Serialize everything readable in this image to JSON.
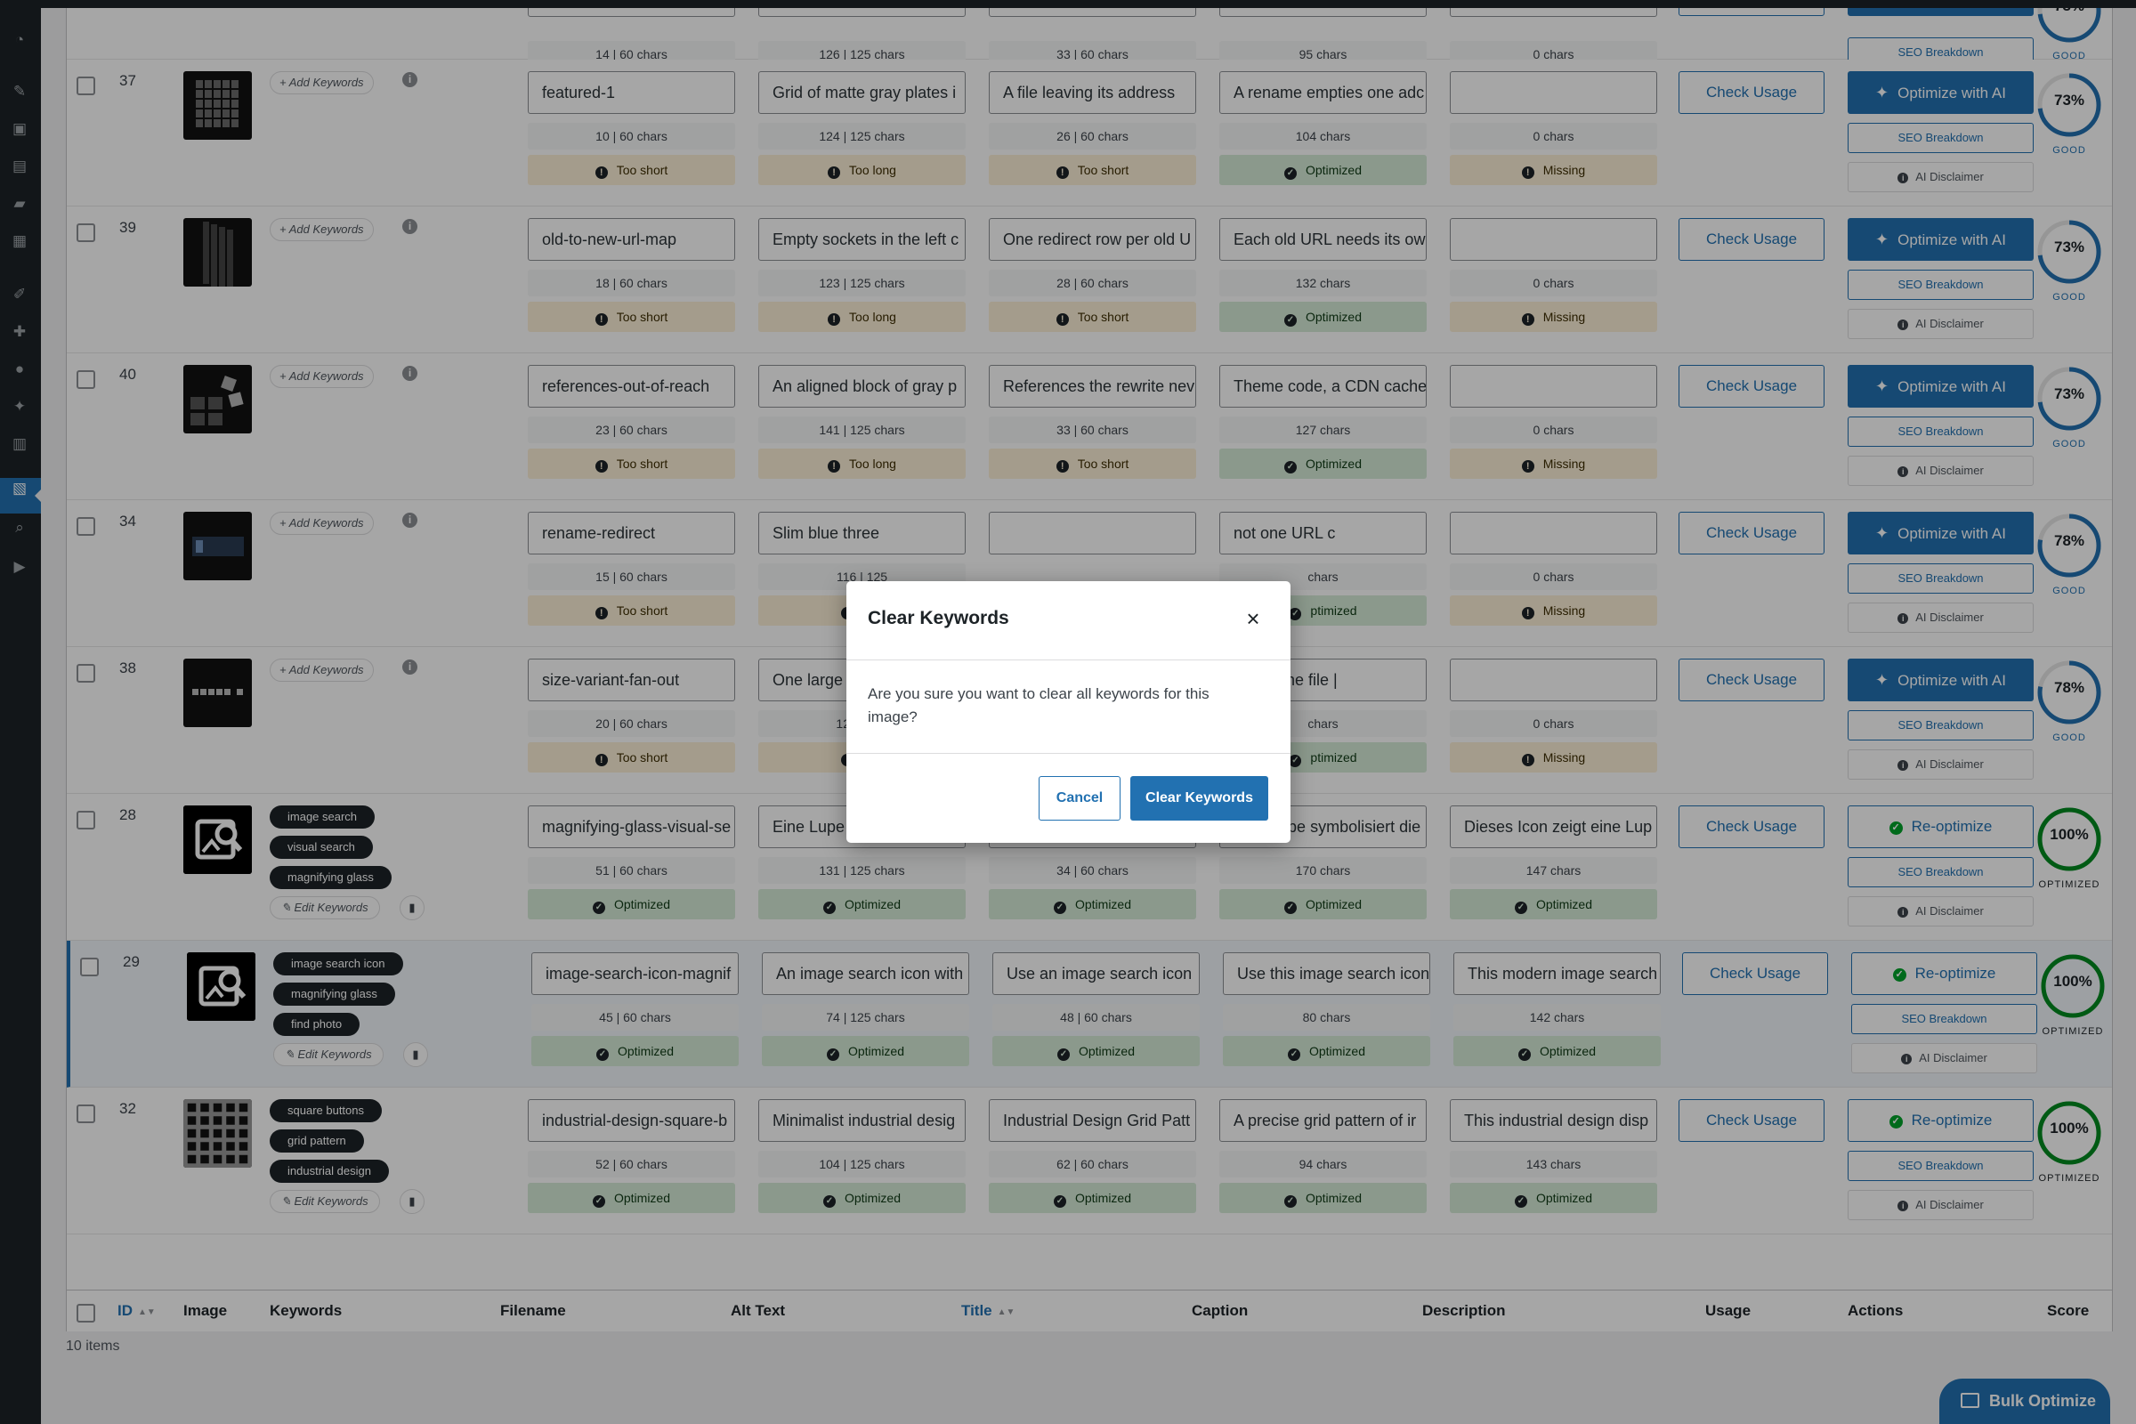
{
  "columns": {
    "id": "ID",
    "image": "Image",
    "keywords": "Keywords",
    "filename": "Filename",
    "alt": "Alt Text",
    "title": "Title",
    "caption": "Caption",
    "description": "Description",
    "usage": "Usage",
    "actions": "Actions",
    "score": "Score"
  },
  "labels": {
    "add_keywords": "Add Keywords",
    "edit_keywords": "Edit Keywords",
    "check_usage": "Check Usage",
    "optimize": "Optimize with AI",
    "reoptimize": "Re-optimize",
    "seo_breakdown": "SEO Breakdown",
    "ai_disclaimer": "AI Disclaimer"
  },
  "top_partial": {
    "counts": [
      "14 | 60 chars",
      "126 | 125 chars",
      "33 | 60 chars",
      "95 chars",
      "0 chars"
    ],
    "statuses": [
      "Too short",
      "Too long",
      "Too short",
      "Optimized",
      "Missing"
    ],
    "score_label": "GOOD",
    "score_pct": "73%",
    "score_value": 0.73,
    "seo_breakdown": "SEO Breakdown",
    "ai_disclaimer": "AI Disclaimer"
  },
  "rows": [
    {
      "id": "37",
      "filename": "featured-1",
      "alt": "Grid of matte gray plates i",
      "title": "A file leaving its address",
      "caption": "A rename empties one adc",
      "description": "",
      "counts": [
        "10 | 60 chars",
        "124 | 125 chars",
        "26 | 60 chars",
        "104 chars",
        "0 chars"
      ],
      "statuses": [
        "Too short",
        "Too long",
        "Too short",
        "Optimized",
        "Missing"
      ],
      "score_pct": "73%",
      "score_value": 0.73,
      "score_label": "GOOD",
      "keywords": [],
      "optimized": false
    },
    {
      "id": "39",
      "filename": "old-to-new-url-map",
      "alt": "Empty sockets in the left c",
      "title": "One redirect row per old U",
      "caption": "Each old URL needs its ow",
      "description": "",
      "counts": [
        "18 | 60 chars",
        "123 | 125 chars",
        "28 | 60 chars",
        "132 chars",
        "0 chars"
      ],
      "statuses": [
        "Too short",
        "Too long",
        "Too short",
        "Optimized",
        "Missing"
      ],
      "score_pct": "73%",
      "score_value": 0.73,
      "score_label": "GOOD",
      "keywords": [],
      "optimized": false
    },
    {
      "id": "40",
      "filename": "references-out-of-reach",
      "alt": "An aligned block of gray p",
      "title": "References the rewrite nev",
      "caption": "Theme code, a CDN cache",
      "description": "",
      "counts": [
        "23 | 60 chars",
        "141 | 125 chars",
        "33 | 60 chars",
        "127 chars",
        "0 chars"
      ],
      "statuses": [
        "Too short",
        "Too long",
        "Too short",
        "Optimized",
        "Missing"
      ],
      "score_pct": "73%",
      "score_value": 0.73,
      "score_label": "GOOD",
      "keywords": [],
      "optimized": false
    },
    {
      "id": "34",
      "filename": "rename-redirect",
      "alt": "Slim blue three",
      "title": "",
      "caption": "not one URL c",
      "description": "",
      "counts": [
        "15 | 60 chars",
        "116 | 125",
        "",
        "chars",
        "0 chars"
      ],
      "statuses": [
        "Too short",
        "Too",
        "",
        "ptimized",
        "Missing"
      ],
      "score_pct": "78%",
      "score_value": 0.78,
      "score_label": "GOOD",
      "keywords": [],
      "optimized": false
    },
    {
      "id": "38",
      "filename": "size-variant-fan-out",
      "alt": "One large gray",
      "title": "",
      "caption": "omes one file |",
      "description": "",
      "counts": [
        "20 | 60 chars",
        "121 | 125",
        "",
        "chars",
        "0 chars"
      ],
      "statuses": [
        "Too short",
        "Too",
        "",
        "ptimized",
        "Missing"
      ],
      "score_pct": "78%",
      "score_value": 0.78,
      "score_label": "GOOD",
      "keywords": [],
      "optimized": false
    },
    {
      "id": "28",
      "filename": "magnifying-glass-visual-se",
      "alt": "Eine Lupe über einem Sym",
      "title": "Image search magnifying",
      "caption": "Eine Lupe symbolisiert die",
      "description": "Dieses Icon zeigt eine Lup",
      "counts": [
        "51 | 60 chars",
        "131 | 125 chars",
        "34 | 60 chars",
        "170 chars",
        "147 chars"
      ],
      "statuses": [
        "Optimized",
        "Optimized",
        "Optimized",
        "Optimized",
        "Optimized"
      ],
      "score_pct": "100%",
      "score_value": 1.0,
      "score_label": "OPTIMIZED",
      "keywords": [
        "image search",
        "visual search",
        "magnifying glass"
      ],
      "optimized": true
    },
    {
      "id": "29",
      "filename": "image-search-icon-magnif",
      "alt": "An image search icon with",
      "title": "Use an image search icon",
      "caption": "Use this image search icon",
      "description": "This modern image search",
      "counts": [
        "45 | 60 chars",
        "74 | 125 chars",
        "48 | 60 chars",
        "80 chars",
        "142 chars"
      ],
      "statuses": [
        "Optimized",
        "Optimized",
        "Optimized",
        "Optimized",
        "Optimized"
      ],
      "score_pct": "100%",
      "score_value": 1.0,
      "score_label": "OPTIMIZED",
      "keywords": [
        "image search icon",
        "magnifying glass",
        "find photo"
      ],
      "optimized": true
    },
    {
      "id": "32",
      "filename": "industrial-design-square-b",
      "alt": "Minimalist industrial desig",
      "title": "Industrial Design Grid Patt",
      "caption": "A precise grid pattern of ir",
      "description": "This industrial design disp",
      "counts": [
        "52 | 60 chars",
        "104 | 125 chars",
        "62 | 60 chars",
        "94 chars",
        "143 chars"
      ],
      "statuses": [
        "Optimized",
        "Optimized",
        "Optimized",
        "Optimized",
        "Optimized"
      ],
      "score_pct": "100%",
      "score_value": 1.0,
      "score_label": "OPTIMIZED",
      "keywords": [
        "square buttons",
        "grid pattern",
        "industrial design"
      ],
      "optimized": true
    }
  ],
  "footer": {
    "items": "10 items"
  },
  "bulk_button": "Bulk Optimize",
  "modal": {
    "title": "Clear Keywords",
    "close": "×",
    "body": "Are you sure you want to clear all keywords for this image?",
    "cancel": "Cancel",
    "confirm": "Clear Keywords"
  },
  "colors": {
    "accent": "#2271b1",
    "ok": "#00a32a",
    "warn_bg": "#fcf0d8",
    "ok_bg": "#d6ebd8",
    "ring_blue": "#2271b1",
    "ring_green": "#008a20"
  }
}
